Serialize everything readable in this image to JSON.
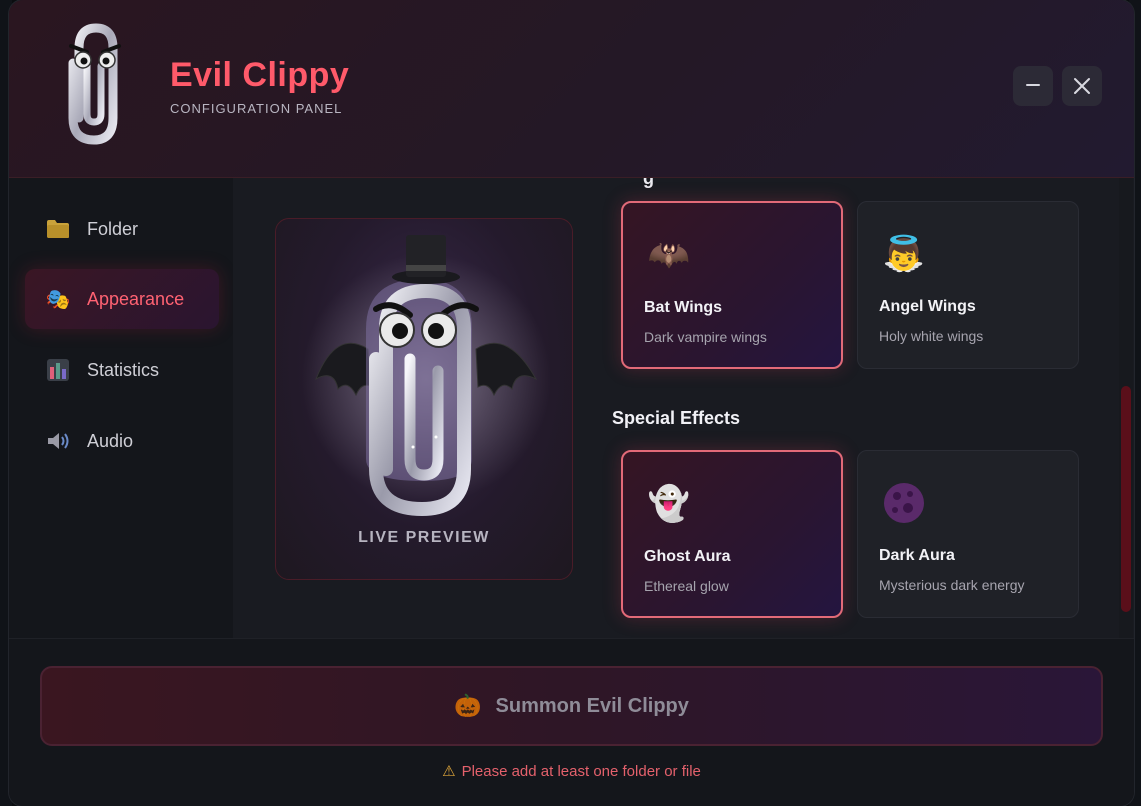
{
  "header": {
    "title": "Evil Clippy",
    "subtitle": "CONFIGURATION PANEL",
    "minimize_icon": "minus-icon",
    "close_icon": "close-icon"
  },
  "sidebar": {
    "items": [
      {
        "label": "Folder",
        "icon": "folder-icon",
        "active": false
      },
      {
        "label": "Appearance",
        "icon": "theater-masks-icon",
        "active": true
      },
      {
        "label": "Statistics",
        "icon": "bar-chart-icon",
        "active": false
      },
      {
        "label": "Audio",
        "icon": "speaker-icon",
        "active": false
      }
    ]
  },
  "preview": {
    "label": "LIVE PREVIEW"
  },
  "wings": {
    "options": [
      {
        "name": "Bat Wings",
        "desc": "Dark vampire wings",
        "icon": "bat-icon",
        "selected": true
      },
      {
        "name": "Angel Wings",
        "desc": "Holy white wings",
        "icon": "angel-icon",
        "selected": false
      }
    ]
  },
  "effects": {
    "title": "Special Effects",
    "options": [
      {
        "name": "Ghost Aura",
        "desc": "Ethereal glow",
        "icon": "ghost-icon",
        "selected": true
      },
      {
        "name": "Dark Aura",
        "desc": "Mysterious dark energy",
        "icon": "dark-moon-icon",
        "selected": false
      }
    ]
  },
  "footer": {
    "summon_label": "Summon Evil Clippy",
    "summon_icon": "jack-o-lantern-icon",
    "warning": "Please add at least one folder or file",
    "warning_icon": "warning-icon"
  },
  "colors": {
    "accent": "#ff5a6a",
    "selected_border": "#e26a78",
    "warning": "#e4616c"
  }
}
